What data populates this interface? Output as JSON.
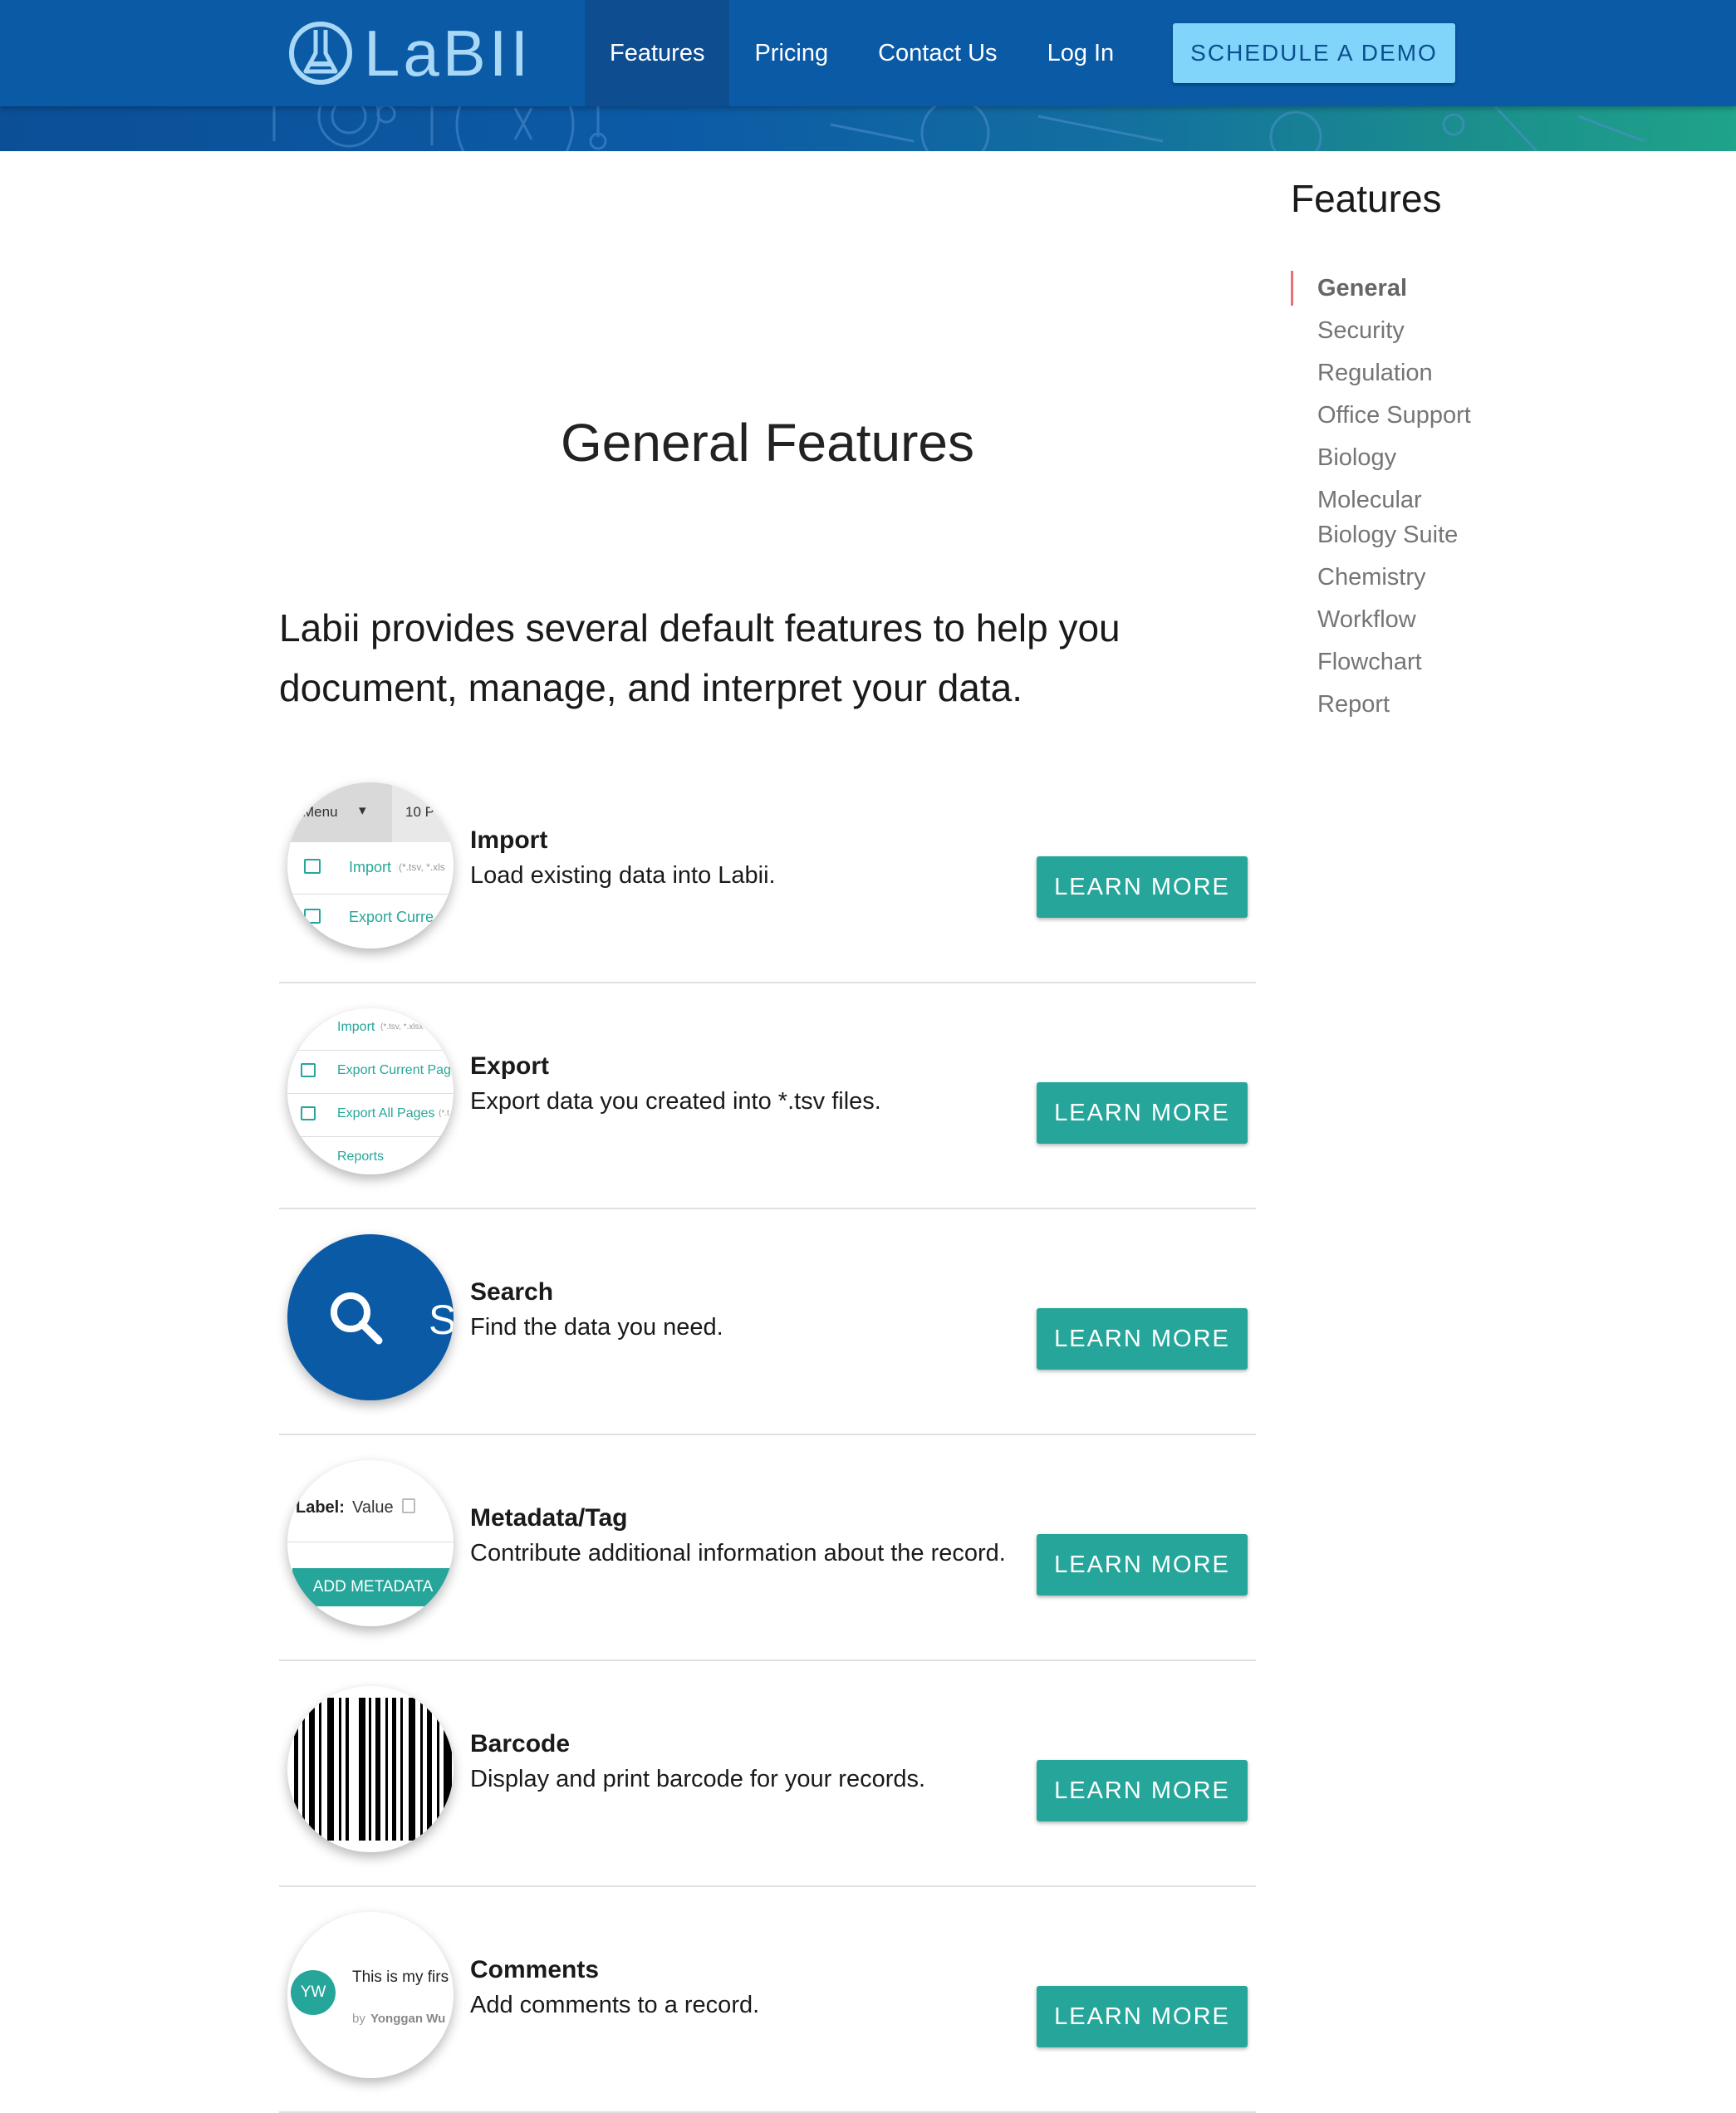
{
  "header": {
    "logo_text": "LaBII",
    "nav": [
      {
        "label": "Features",
        "active": true
      },
      {
        "label": "Pricing",
        "active": false
      },
      {
        "label": "Contact Us",
        "active": false
      },
      {
        "label": "Log In",
        "active": false
      }
    ],
    "demo_button": "SCHEDULE A DEMO"
  },
  "main": {
    "title": "General Features",
    "intro": "Labii provides several default features to help you document, manage, and interpret your data.",
    "features": [
      {
        "title": "Import",
        "description": "Load existing data into Labii.",
        "button": "LEARN MORE",
        "thumb": {
          "menu": "Menu",
          "pages": "10 P",
          "import": "Import",
          "import_ext": "(*.tsv, *.xls",
          "export": "Export Curre"
        }
      },
      {
        "title": "Export",
        "description": "Export data you created into *.tsv files.",
        "button": "LEARN MORE",
        "thumb": {
          "import": "Import",
          "import_ext": "(*.tsv, *.xlsx",
          "export_current": "Export Current Pag",
          "export_all": "Export All Pages",
          "export_all_ext": "(*.t",
          "reports": "Reports"
        }
      },
      {
        "title": "Search",
        "description": "Find the data you need.",
        "button": "LEARN MORE",
        "thumb": {
          "letter": "S"
        }
      },
      {
        "title": "Metadata/Tag",
        "description": "Contribute additional information about the record.",
        "button": "LEARN MORE",
        "thumb": {
          "label": "Label:",
          "value": "Value",
          "button": "ADD METADATA"
        }
      },
      {
        "title": "Barcode",
        "description": "Display and print barcode for your records.",
        "button": "LEARN MORE"
      },
      {
        "title": "Comments",
        "description": "Add comments to a record.",
        "button": "LEARN MORE",
        "thumb": {
          "initials": "YW",
          "text": "This is my firs",
          "by": "by",
          "author": "Yonggan Wu"
        }
      }
    ]
  },
  "sidebar": {
    "title": "Features",
    "items": [
      {
        "label": "General",
        "active": true
      },
      {
        "label": "Security",
        "active": false
      },
      {
        "label": "Regulation",
        "active": false
      },
      {
        "label": "Office Support",
        "active": false
      },
      {
        "label": "Biology",
        "active": false
      },
      {
        "label": "Molecular Biology Suite",
        "active": false
      },
      {
        "label": "Chemistry",
        "active": false
      },
      {
        "label": "Workflow",
        "active": false
      },
      {
        "label": "Flowchart",
        "active": false
      },
      {
        "label": "Report",
        "active": false
      }
    ]
  },
  "colors": {
    "header_bg": "#0b5aa6",
    "demo_button_bg": "#81d4fa",
    "accent_teal": "#26a69a",
    "sidebar_active_marker": "#ee6e73"
  }
}
